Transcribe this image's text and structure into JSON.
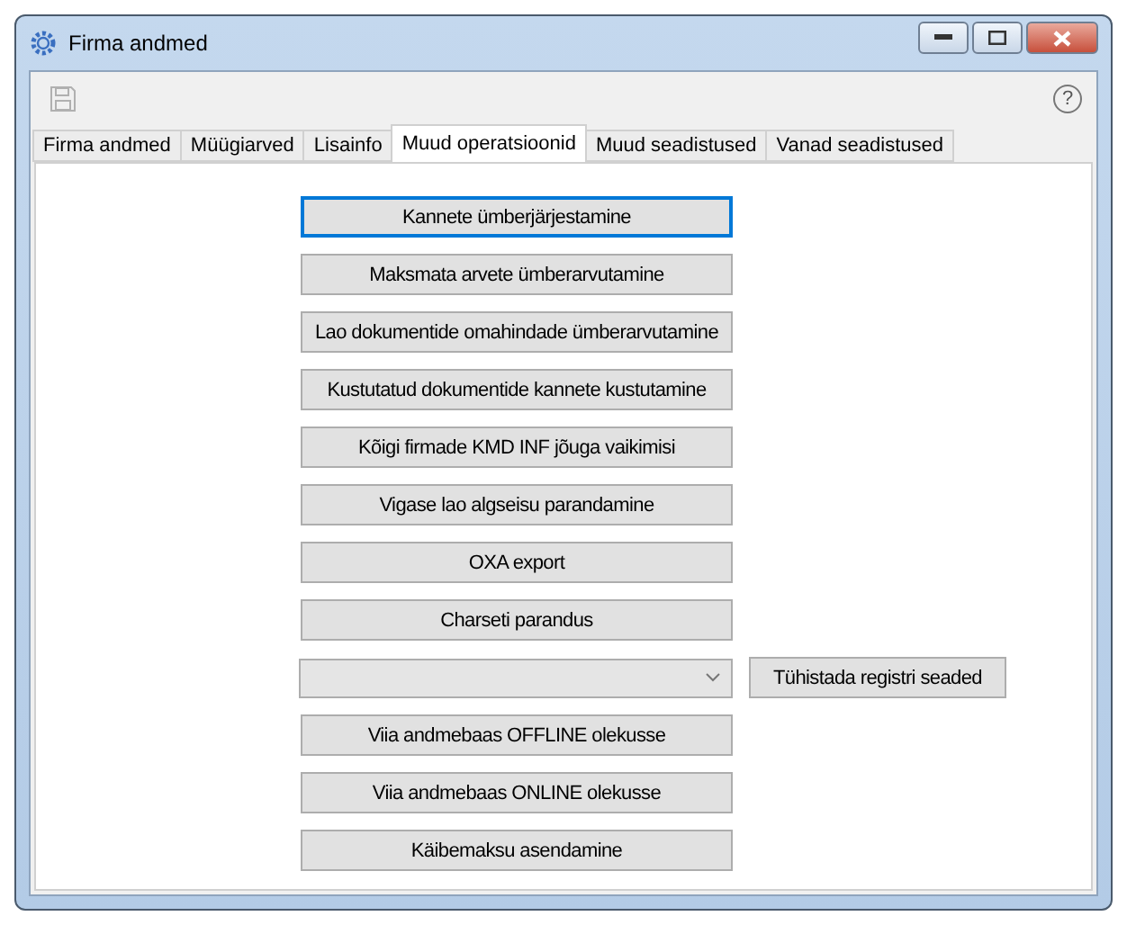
{
  "window": {
    "title": "Firma andmed"
  },
  "toolbar": {
    "save_disabled": true,
    "help": "?"
  },
  "tabs": [
    {
      "label": "Firma andmed",
      "selected": false
    },
    {
      "label": "Müügiarved",
      "selected": false
    },
    {
      "label": "Lisainfo",
      "selected": false
    },
    {
      "label": "Muud operatsioonid",
      "selected": true
    },
    {
      "label": "Muud seadistused",
      "selected": false
    },
    {
      "label": "Vanad seadistused",
      "selected": false
    }
  ],
  "actions": [
    {
      "kind": "button",
      "label": "Kannete ümberjärjestamine",
      "focused": true
    },
    {
      "kind": "button",
      "label": "Maksmata arvete ümberarvutamine",
      "focused": false
    },
    {
      "kind": "button",
      "label": "Lao dokumentide omahindade ümberarvutamine",
      "focused": false
    },
    {
      "kind": "button",
      "label": "Kustutatud dokumentide kannete kustutamine",
      "focused": false
    },
    {
      "kind": "button",
      "label": "Kõigi firmade KMD INF jõuga vaikimisi",
      "focused": false
    },
    {
      "kind": "button",
      "label": "Vigase lao algseisu parandamine",
      "focused": false
    },
    {
      "kind": "button",
      "label": "OXA export",
      "focused": false
    },
    {
      "kind": "button",
      "label": "Charseti parandus",
      "focused": false
    },
    {
      "kind": "combo",
      "label": "Tühistada registri seaded",
      "focused": false
    },
    {
      "kind": "button",
      "label": "Viia andmebaas OFFLINE olekusse",
      "focused": false
    },
    {
      "kind": "button",
      "label": "Viia andmebaas ONLINE olekusse",
      "focused": false
    },
    {
      "kind": "button",
      "label": "Käibemaksu asendamine",
      "focused": false
    }
  ]
}
